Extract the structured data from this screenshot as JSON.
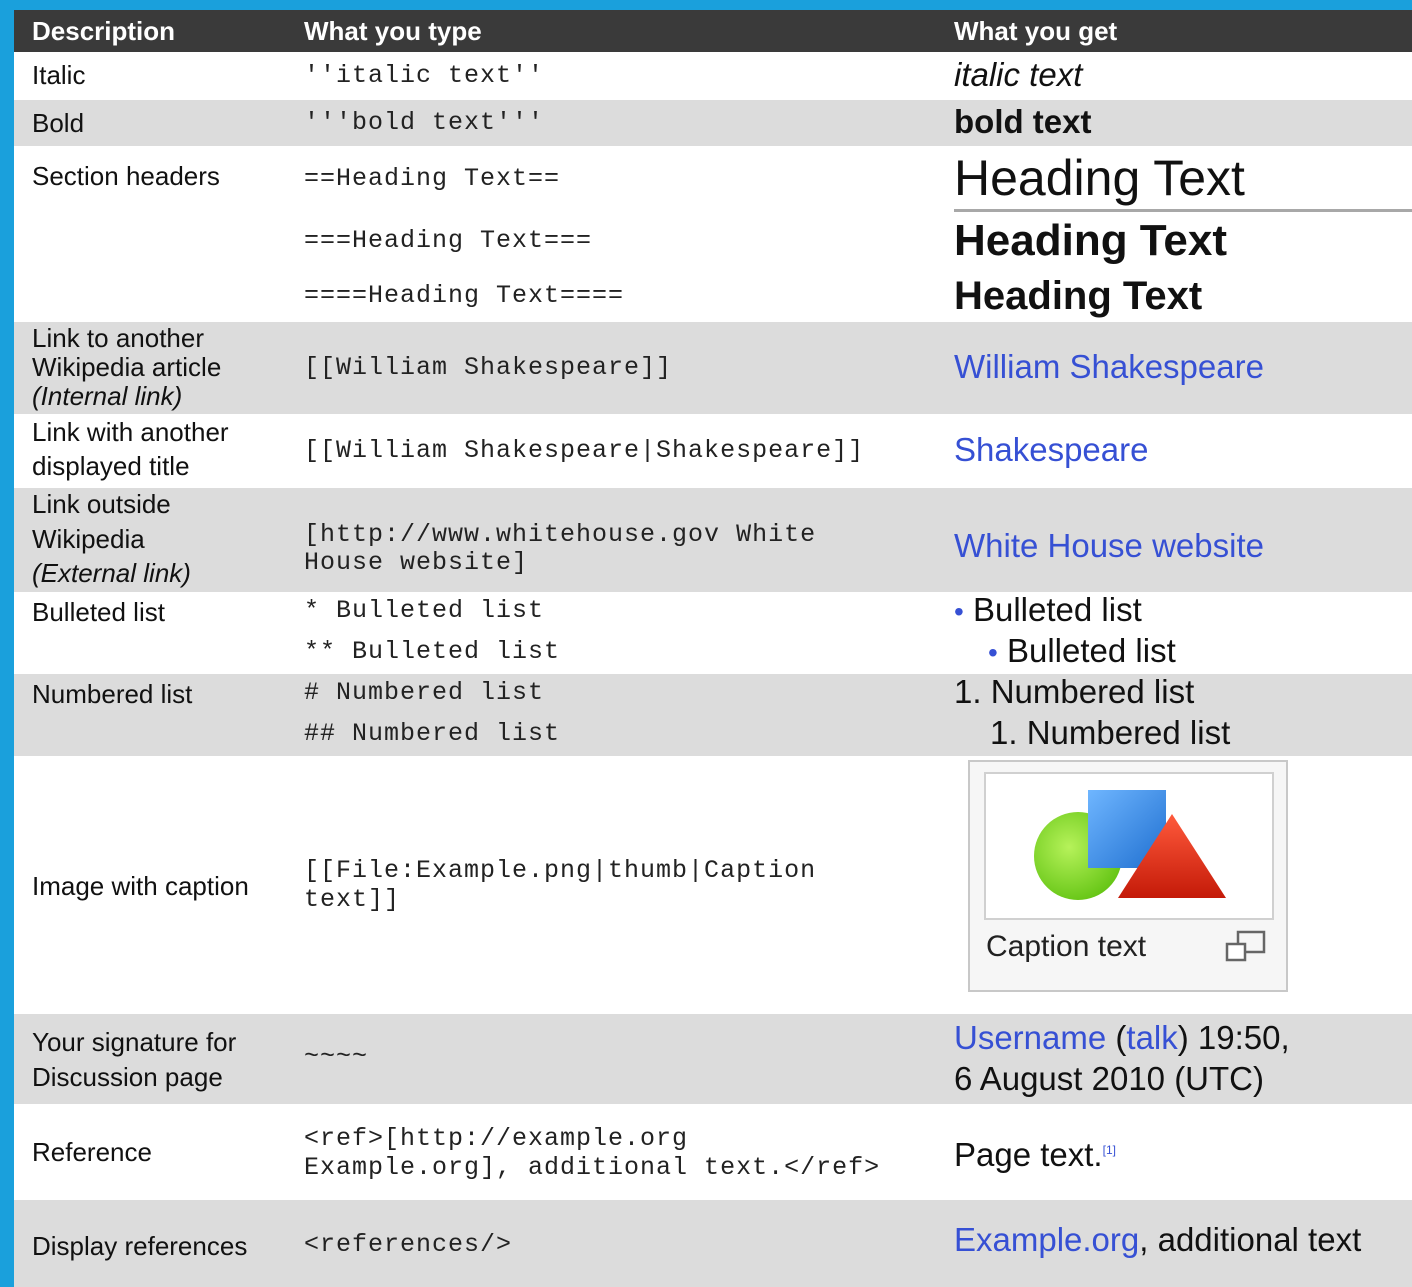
{
  "header": {
    "col1": "Description",
    "col2": "What you type",
    "col3": "What you get"
  },
  "rows": {
    "italic": {
      "desc": "Italic",
      "code": "''italic text''",
      "out": "italic text"
    },
    "bold": {
      "desc": "Bold",
      "code": "'''bold text'''",
      "out": "bold text"
    },
    "headers": {
      "desc": "Section headers",
      "code1": "==Heading Text==",
      "code2": "===Heading Text===",
      "code3": "====Heading Text====",
      "out1": "Heading Text",
      "out2": "Heading Text",
      "out3": "Heading Text"
    },
    "internal": {
      "desc1": "Link to another",
      "desc2": "Wikipedia article",
      "desc3": "(Internal link)",
      "code": "[[William Shakespeare]]",
      "out": "William Shakespeare"
    },
    "piped": {
      "desc1": "Link with another",
      "desc2": "displayed title",
      "code": "[[William Shakespeare|Shakespeare]]",
      "out": "Shakespeare"
    },
    "external": {
      "desc1": "Link outside",
      "desc2": "Wikipedia",
      "desc3": "(External link)",
      "code1": "[http://www.whitehouse.gov White",
      "code2": "House website]",
      "out": "White House website"
    },
    "bulleted": {
      "desc": "Bulleted list",
      "code1": "* Bulleted list",
      "code2": "** Bulleted list",
      "bullet": "•",
      "out1": "Bulleted list",
      "out2": "Bulleted list"
    },
    "numbered": {
      "desc": "Numbered list",
      "code1": "# Numbered list",
      "code2": "## Numbered list",
      "out1": "1. Numbered list",
      "out2": "1. Numbered list"
    },
    "image": {
      "desc": "Image with caption",
      "code1": "[[File:Example.png|thumb|Caption",
      "code2": "text]]",
      "caption": "Caption text",
      "colors": {
        "circle": "#7ed321",
        "square": "#3d8fe8",
        "triangle": "#d42a10"
      }
    },
    "signature": {
      "desc1": "Your signature for",
      "desc2": "Discussion page",
      "code": "~~~~",
      "user": "Username",
      "open_paren": "(",
      "talk": "talk",
      "close_time": ") 19:50,",
      "date": "6 August 2010 (UTC)"
    },
    "reference": {
      "desc": "Reference",
      "code1": "<ref>[http://example.org",
      "code2": "Example.org], additional text.</ref>",
      "out": "Page text.",
      "sup": "[1]"
    },
    "display_refs": {
      "desc": "Display references",
      "code": "<references/>",
      "link": "Example.org",
      "rest": ", additional text"
    }
  },
  "colors": {
    "link": "#3650d4",
    "header_bg": "#3a3a3a",
    "stripe": "#dcdcdc",
    "frame": "#1aa0dc"
  }
}
